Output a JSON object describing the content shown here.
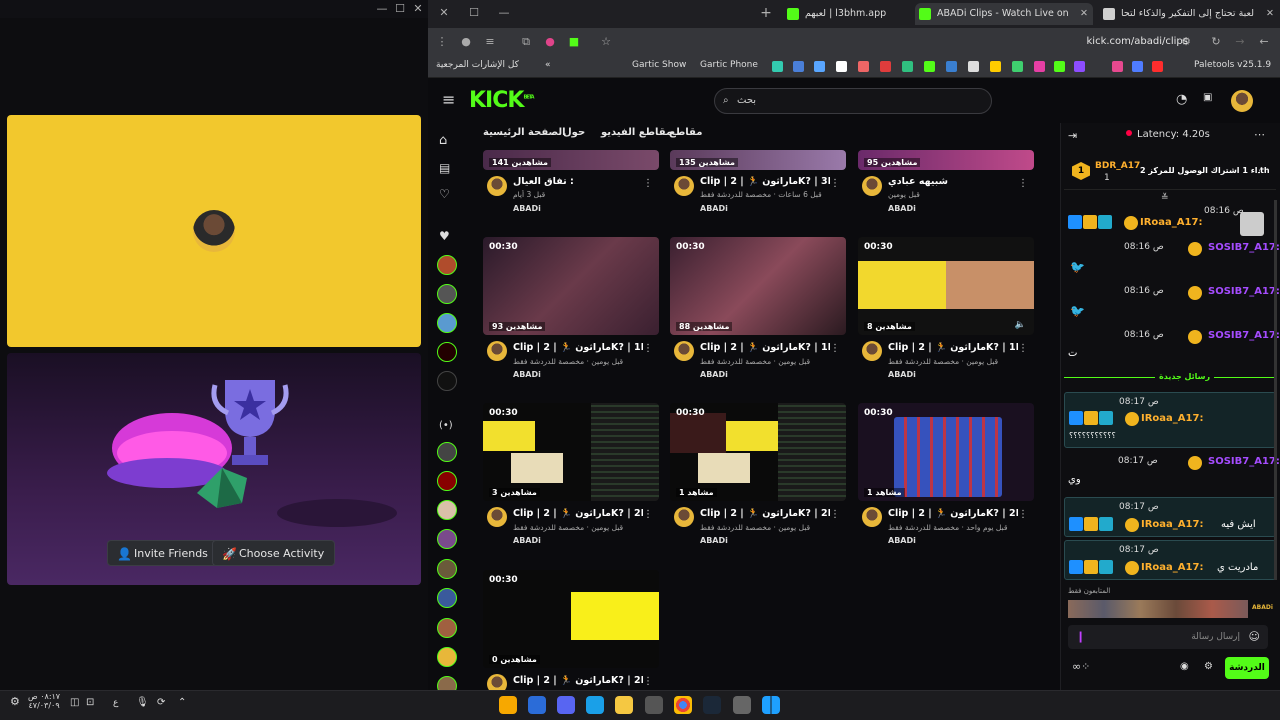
{
  "left_window": {
    "buttons": {
      "invite": "Invite Friends",
      "choose": "Choose Activity"
    }
  },
  "browser": {
    "tabs": [
      {
        "title": "ABADi Clips - Watch Live on",
        "active": true,
        "color": "#53fc18"
      },
      {
        "title": "لعبة تحتاج إلى التفكير والذكاء لتحا",
        "active": false,
        "color": "#53fc18"
      },
      {
        "title": "لعبهم | l3bhm.app",
        "active": false,
        "color": "#cfcfcf"
      }
    ],
    "url": "kick.com/abadi/clips",
    "bookmarks": {
      "all": "كل الإشارات المرجعية",
      "gartic_show": "Gartic Show",
      "gartic_phone": "Gartic Phone",
      "paletools": "Paletools v25.1.9"
    }
  },
  "kick": {
    "logo": "KICK",
    "logo_beta": "BETA",
    "search_placeholder": "بحث",
    "nav": {
      "home": "الصفحة الرئيسية",
      "about": "حول",
      "videos": "مقاطع الفيديو",
      "clips": "مقاطع"
    },
    "clips": [
      {
        "duration": "",
        "views": "141 مشاهدين",
        "title": "تفاق العيال :",
        "meta": "قبل 3 أيام",
        "channel": "ABADi"
      },
      {
        "duration": "",
        "views": "135 مشاهدين",
        "title": "Clip | ماراثون 🏃 | 2K? | 3D",
        "meta": "قبل 6 ساعات · مخصصة للدردشة فقط",
        "channel": "ABADi"
      },
      {
        "duration": "",
        "views": "95 مشاهدين",
        "title": "شبيهه عبادي",
        "meta": "قبل يومين",
        "channel": "ABADi"
      },
      {
        "duration": "00:30",
        "views": "93 مشاهدين",
        "title": "Clip | ماراثون 🏃 | 2K? | 1D",
        "meta": "قبل يومين · مخصصة للدردشة فقط",
        "channel": "ABADi"
      },
      {
        "duration": "00:30",
        "views": "88 مشاهدين",
        "title": "Clip | ماراثون 🏃 | 2K? | 1D",
        "meta": "قبل يومين · مخصصة للدردشة فقط",
        "channel": "ABADi"
      },
      {
        "duration": "00:30",
        "views": "8 مشاهدين",
        "title": "Clip | ماراثون 🏃 | 2K? | 1D",
        "meta": "قبل يومين · مخصصة للدردشة فقط",
        "channel": "ABADi"
      },
      {
        "duration": "00:30",
        "views": "3 مشاهدين",
        "title": "Clip | ماراثون 🏃 | 2K? | 2D",
        "meta": "قبل يومين · مخصصة للدردشة فقط",
        "channel": "ABADi"
      },
      {
        "duration": "00:30",
        "views": "1 مشاهد",
        "title": "Clip | ماراثون 🏃 | 2K? | 2D",
        "meta": "قبل يومين · مخصصة للدردشة فقط",
        "channel": "ABADi"
      },
      {
        "duration": "00:30",
        "views": "1 مشاهد",
        "title": "Clip | ماراثون 🏃 | 2K? | 2D",
        "meta": "قبل يوم واحد · مخصصة للدردشة فقط",
        "channel": "ABADi"
      },
      {
        "duration": "00:30",
        "views": "0 مشاهدين",
        "title": "Clip | ماراثون 🏃 | 2K? | 2D",
        "meta": "",
        "channel": ""
      }
    ]
  },
  "chat": {
    "latency": "Latency: 4.20s",
    "pinned_user": "BDR_A17",
    "pinned_count": "1",
    "pinned_text": "إهداء 1 اشتراك الوصول للمركز 2 🏆",
    "pinned_suffix": "th",
    "new_messages": "رسائل جديدة",
    "messages": [
      {
        "time": "08:16 ص",
        "user": "IRoaa_A17:",
        "text": ""
      },
      {
        "time": "08:16 ص",
        "user": "SOSIB7_A17:",
        "text": ""
      },
      {
        "time": "08:16 ص",
        "user": "SOSIB7_A17:",
        "text": ""
      },
      {
        "time": "08:16 ص",
        "user": "SOSIB7_A17:",
        "text": "ت"
      },
      {
        "time": "08:17 ص",
        "user": "IRoaa_A17:",
        "text": "؟؟؟؟؟؟؟؟؟؟؟"
      },
      {
        "time": "08:17 ص",
        "user": "SOSIB7_A17:",
        "text": "وي"
      },
      {
        "time": "08:17 ص",
        "user": "IRoaa_A17:",
        "text": "ايش فيه"
      },
      {
        "time": "08:17 ص",
        "user": "IRoaa_A17:",
        "text": "مادريت ي"
      }
    ],
    "followers_label": "المتابعون فقط",
    "input_placeholder": "إرسال رسالة",
    "send": "الدردشة",
    "channel_tag": "ABADi"
  },
  "taskbar": {
    "time": "٠٨:١٧ ص",
    "date": "٤٧/٠٣/٠٩",
    "lang": "ع"
  },
  "colors": {
    "kick_green": "#53fc18",
    "yellow": "#f2c82d",
    "purple_user": "#a54cff",
    "orange_user": "#ffb02e"
  }
}
